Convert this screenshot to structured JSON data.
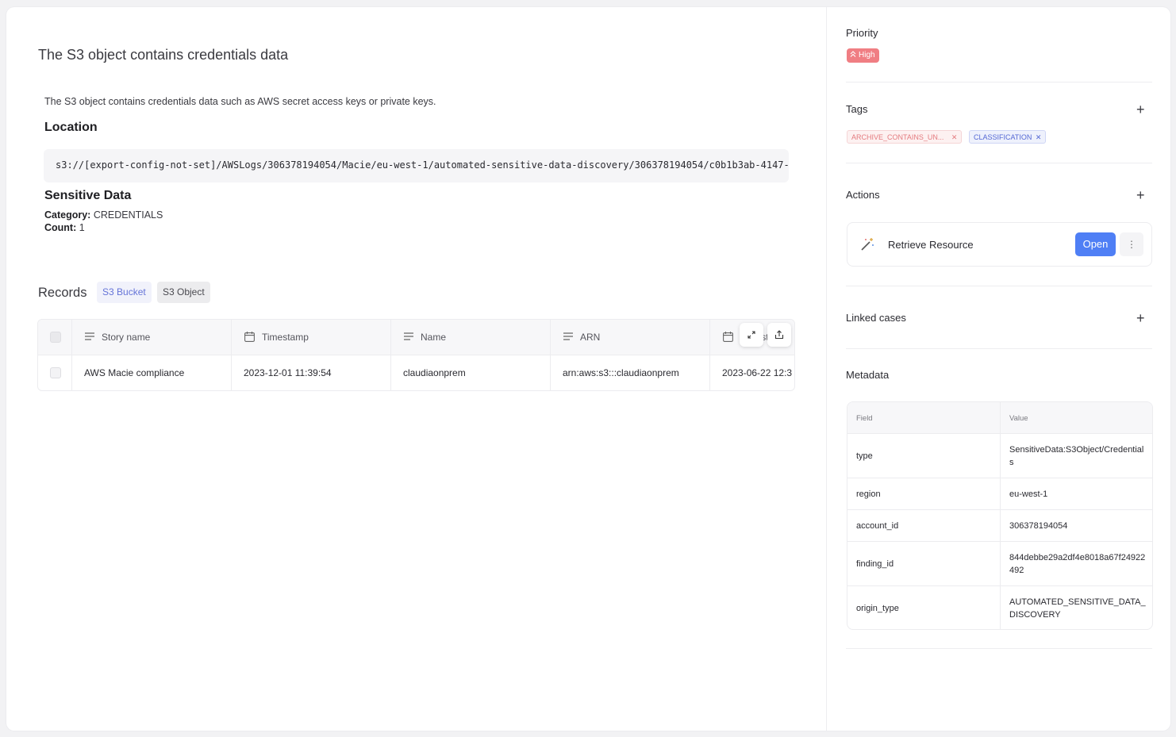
{
  "main": {
    "title": "The S3 object contains credentials data",
    "description": "The S3 object contains credentials data such as AWS secret access keys or private keys.",
    "location_heading": "Location",
    "location_path": "s3://[export-config-not-set]/AWSLogs/306378194054/Macie/eu-west-1/automated-sensitive-data-discovery/306378194054/c0b1b3ab-4147-",
    "sensitive_heading": "Sensitive Data",
    "category_label": "Category:",
    "category_value": "CREDENTIALS",
    "count_label": "Count:",
    "count_value": "1"
  },
  "records": {
    "title": "Records",
    "tabs": [
      "S3 Bucket",
      "S3 Object"
    ],
    "columns": [
      "Story name",
      "Timestamp",
      "Name",
      "ARN",
      "Timestamp"
    ],
    "rows": [
      [
        "AWS Macie compliance",
        "2023-12-01 11:39:54",
        "claudiaonprem",
        "arn:aws:s3:::claudiaonprem",
        "2023-06-22 12:3"
      ]
    ]
  },
  "side": {
    "priority_label": "Priority",
    "priority_value": "High",
    "tags_label": "Tags",
    "tags": [
      "ARCHIVE_CONTAINS_UN...",
      "CLASSIFICATION"
    ],
    "actions_label": "Actions",
    "action_name": "Retrieve Resource",
    "open_label": "Open",
    "linked_label": "Linked cases",
    "metadata_label": "Metadata",
    "meta_headers": [
      "Field",
      "Value"
    ],
    "meta_rows": [
      [
        "type",
        "SensitiveData:S3Object/Credentials"
      ],
      [
        "region",
        "eu-west-1"
      ],
      [
        "account_id",
        "306378194054"
      ],
      [
        "finding_id",
        "844debbe29a2df4e8018a67f24922492"
      ],
      [
        "origin_type",
        "AUTOMATED_SENSITIVE_DATA_DISCOVERY"
      ]
    ]
  },
  "colors": {
    "accent": "#4f7ff5",
    "priority_high": "#f07e83"
  }
}
